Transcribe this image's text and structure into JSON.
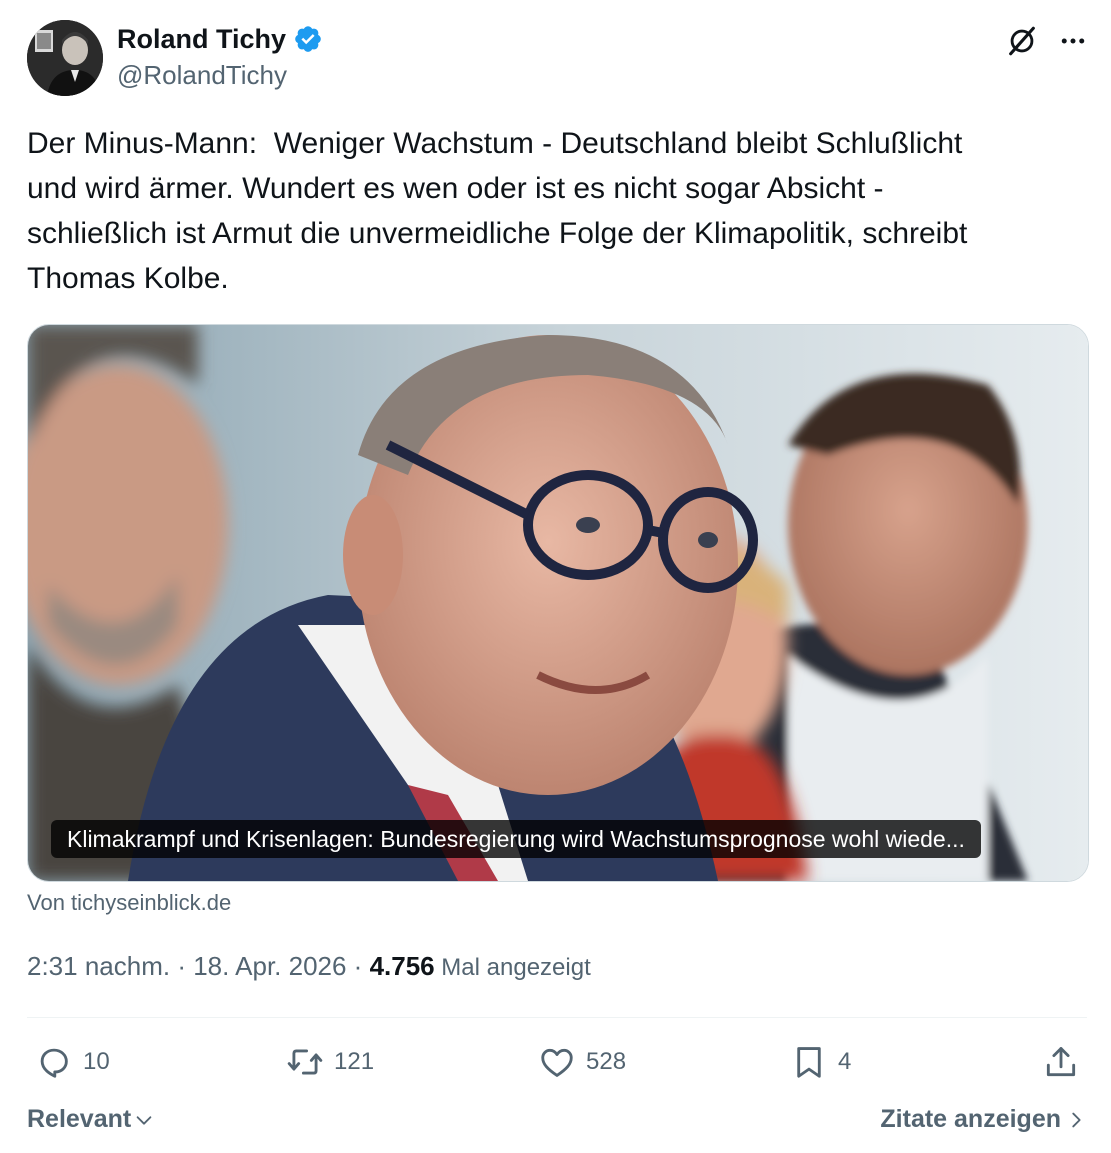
{
  "author": {
    "name": "Roland Tichy",
    "handle": "@RolandTichy",
    "verified_color": "#1d9bf0"
  },
  "tweet": {
    "text": "Der Minus-Mann:  Weniger Wachstum - Deutschland bleibt Schlußlicht\nund wird ärmer. Wundert es wen oder ist es nicht sogar Absicht -\nschließlich ist Armut die unvermeidliche Folge der Klimapolitik, schreibt\nThomas Kolbe."
  },
  "card": {
    "title": "Klimakrampf und Krisenlagen: Bundesregierung wird Wachstumsprognose wohl wiede...",
    "source": "Von tichyseinblick.de"
  },
  "meta": {
    "time": "2:31 nachm.",
    "separator": " · ",
    "date": "18. Apr. 2026",
    "views_count": "4.756",
    "views_label": " Mal angezeigt"
  },
  "actions": {
    "replies": "10",
    "reposts": "121",
    "likes": "528",
    "bookmarks": "4"
  },
  "footer": {
    "sort_label": "Relevant",
    "quotes_label": "Zitate anzeigen"
  },
  "icons": {
    "grok": "grok-icon",
    "more": "more-icon",
    "reply": "reply-icon",
    "repost": "repost-icon",
    "like": "heart-icon",
    "bookmark": "bookmark-icon",
    "share": "share-icon"
  },
  "colors": {
    "text": "#0f1419",
    "secondary": "#536471",
    "accent": "#1d9bf0",
    "border": "#cfd9de"
  }
}
